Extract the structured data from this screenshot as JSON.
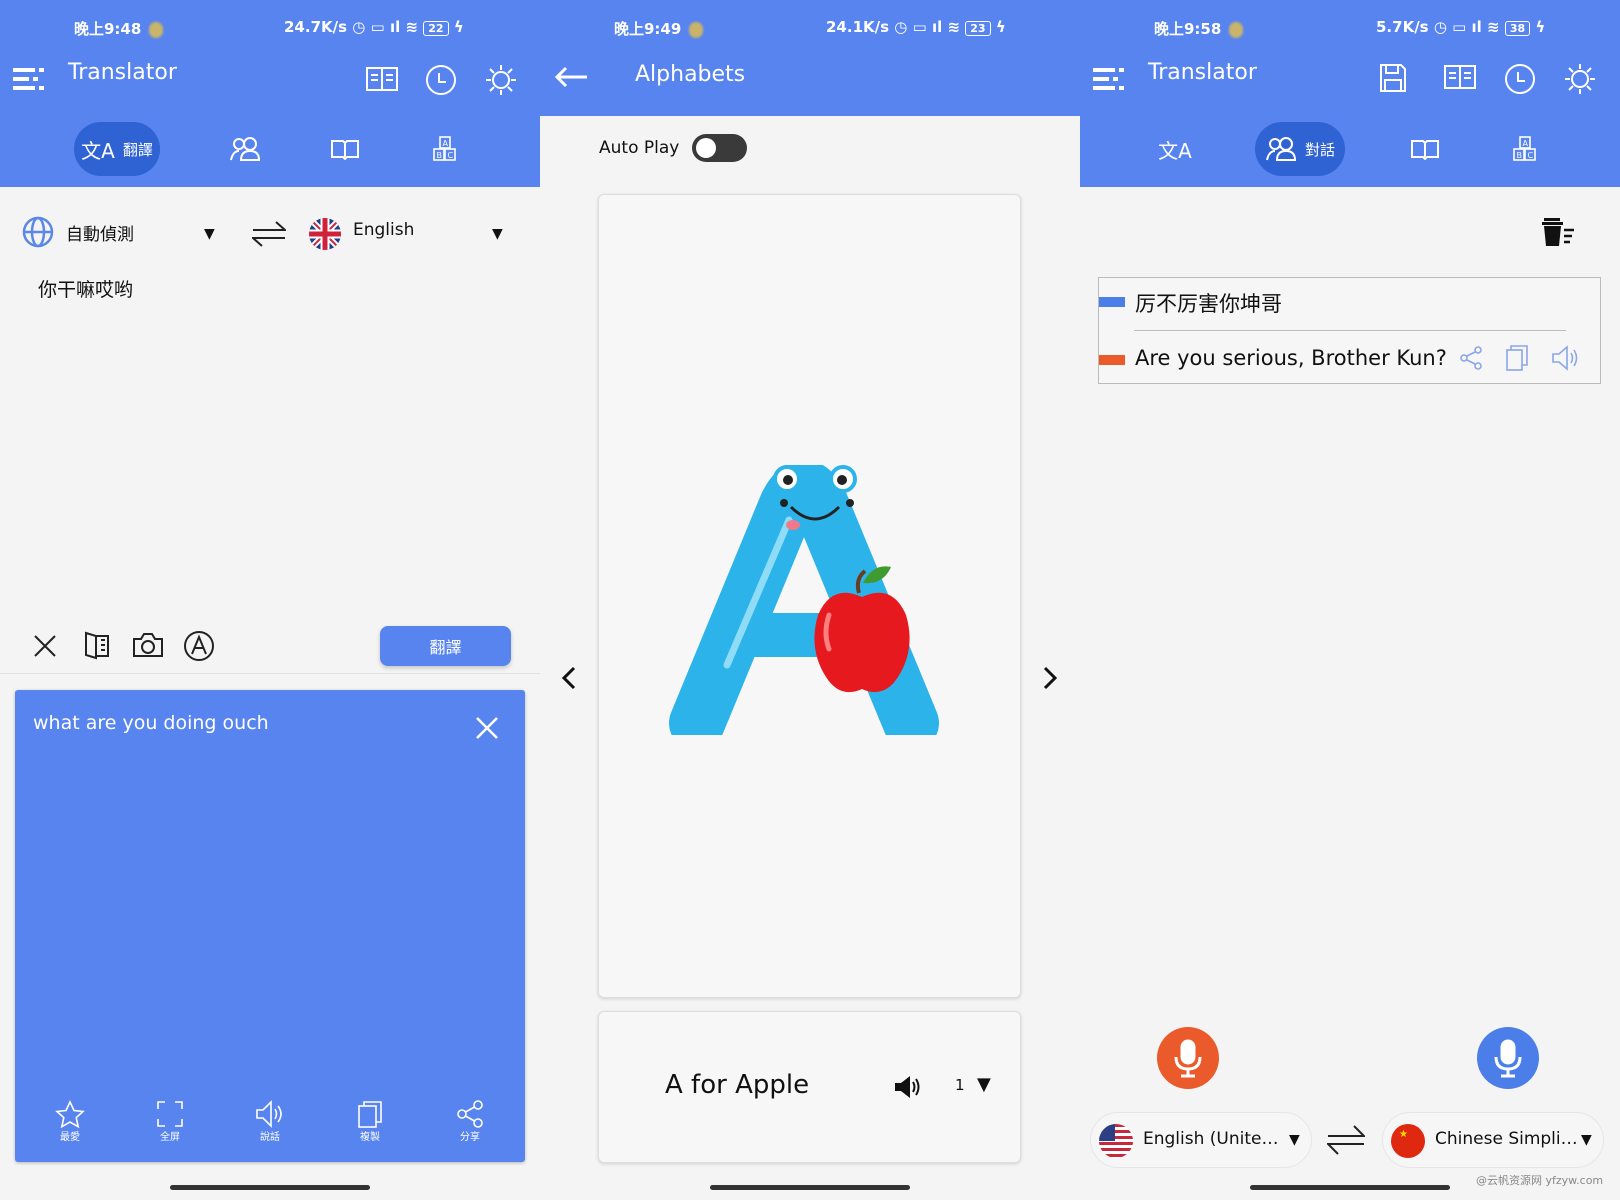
{
  "colors": {
    "primary": "#5884ef",
    "active_tab": "#2f62d3",
    "speaker_a": "#ea5a2a",
    "speaker_b": "#4b7ee8"
  },
  "left": {
    "status": {
      "time": "晚上9:48",
      "speed": "24.7K/s",
      "battery": "22"
    },
    "app_title": "Translator",
    "tabs": [
      {
        "label": "翻譯",
        "icon": "translate-icon"
      },
      {
        "icon": "conversation-icon"
      },
      {
        "icon": "book-icon"
      },
      {
        "icon": "alphabet-blocks-icon"
      }
    ],
    "source_lang": "自動偵測",
    "target_lang": "English",
    "input_text": "你干嘛哎哟",
    "translate_button": "翻譯",
    "result_text": "what are you doing ouch",
    "result_actions": [
      {
        "label": "最愛",
        "icon": "star-icon"
      },
      {
        "label": "全屏",
        "icon": "fullscreen-icon"
      },
      {
        "label": "說話",
        "icon": "speaker-icon"
      },
      {
        "label": "複製",
        "icon": "copy-icon"
      },
      {
        "label": "分享",
        "icon": "share-icon"
      }
    ]
  },
  "middle": {
    "status": {
      "time": "晚上9:49",
      "speed": "24.1K/s",
      "battery": "23"
    },
    "title": "Alphabets",
    "auto_play_label": "Auto Play",
    "auto_play_on": false,
    "letter": "A",
    "caption": "A for Apple",
    "speed_value": "1"
  },
  "right": {
    "status": {
      "time": "晚上9:58",
      "speed": "5.7K/s",
      "battery": "38"
    },
    "app_title": "Translator",
    "tabs": [
      {
        "icon": "translate-icon"
      },
      {
        "label": "對話",
        "icon": "conversation-icon"
      },
      {
        "icon": "book-icon"
      },
      {
        "icon": "alphabet-blocks-icon"
      }
    ],
    "conversation": [
      {
        "text": "厉不厉害你坤哥",
        "speaker": "a"
      },
      {
        "text": "Are you serious, Brother Kun?",
        "speaker": "b"
      }
    ],
    "lang_a": "English (Unite…",
    "lang_b": "Chinese Simpli…",
    "watermark": "@云帆资源网 yfzyw.com"
  }
}
